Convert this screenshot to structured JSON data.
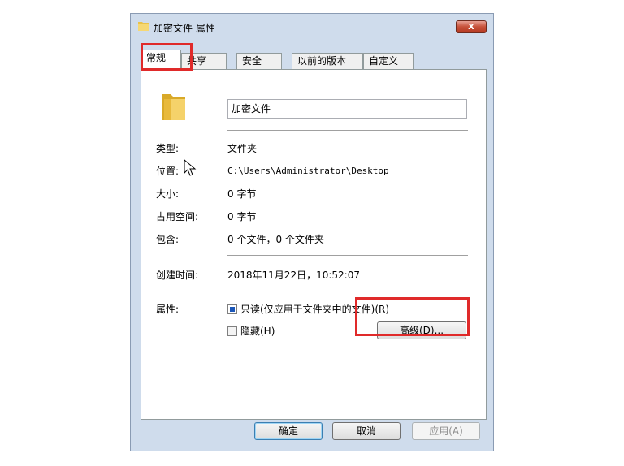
{
  "window": {
    "title": "加密文件 属性",
    "close_label": "x"
  },
  "tabs": [
    {
      "label": "常规",
      "active": true
    },
    {
      "label": "共享",
      "active": false
    },
    {
      "label": "安全",
      "active": false
    },
    {
      "label": "以前的版本",
      "active": false
    },
    {
      "label": "自定义",
      "active": false
    }
  ],
  "general": {
    "folder_name": "加密文件",
    "type_label": "类型:",
    "type_value": "文件夹",
    "location_label": "位置:",
    "location_value": "C:\\Users\\Administrator\\Desktop",
    "size_label": "大小:",
    "size_value": "0 字节",
    "disk_size_label": "占用空间:",
    "disk_size_value": "0 字节",
    "contains_label": "包含:",
    "contains_value": "0 个文件，0 个文件夹",
    "created_label": "创建时间:",
    "created_value": "2018年11月22日，10:52:07",
    "attributes_label": "属性:",
    "readonly_label": "只读(仅应用于文件夹中的文件)(R)",
    "readonly_checked": true,
    "hidden_label": "隐藏(H)",
    "hidden_checked": false,
    "advanced_label": "高级(D)..."
  },
  "buttons": {
    "ok": "确定",
    "cancel": "取消",
    "apply": "应用(A)"
  },
  "colors": {
    "highlight": "#e02a2a",
    "frame": "#cfdcec",
    "check_fill": "#1a56b8"
  }
}
